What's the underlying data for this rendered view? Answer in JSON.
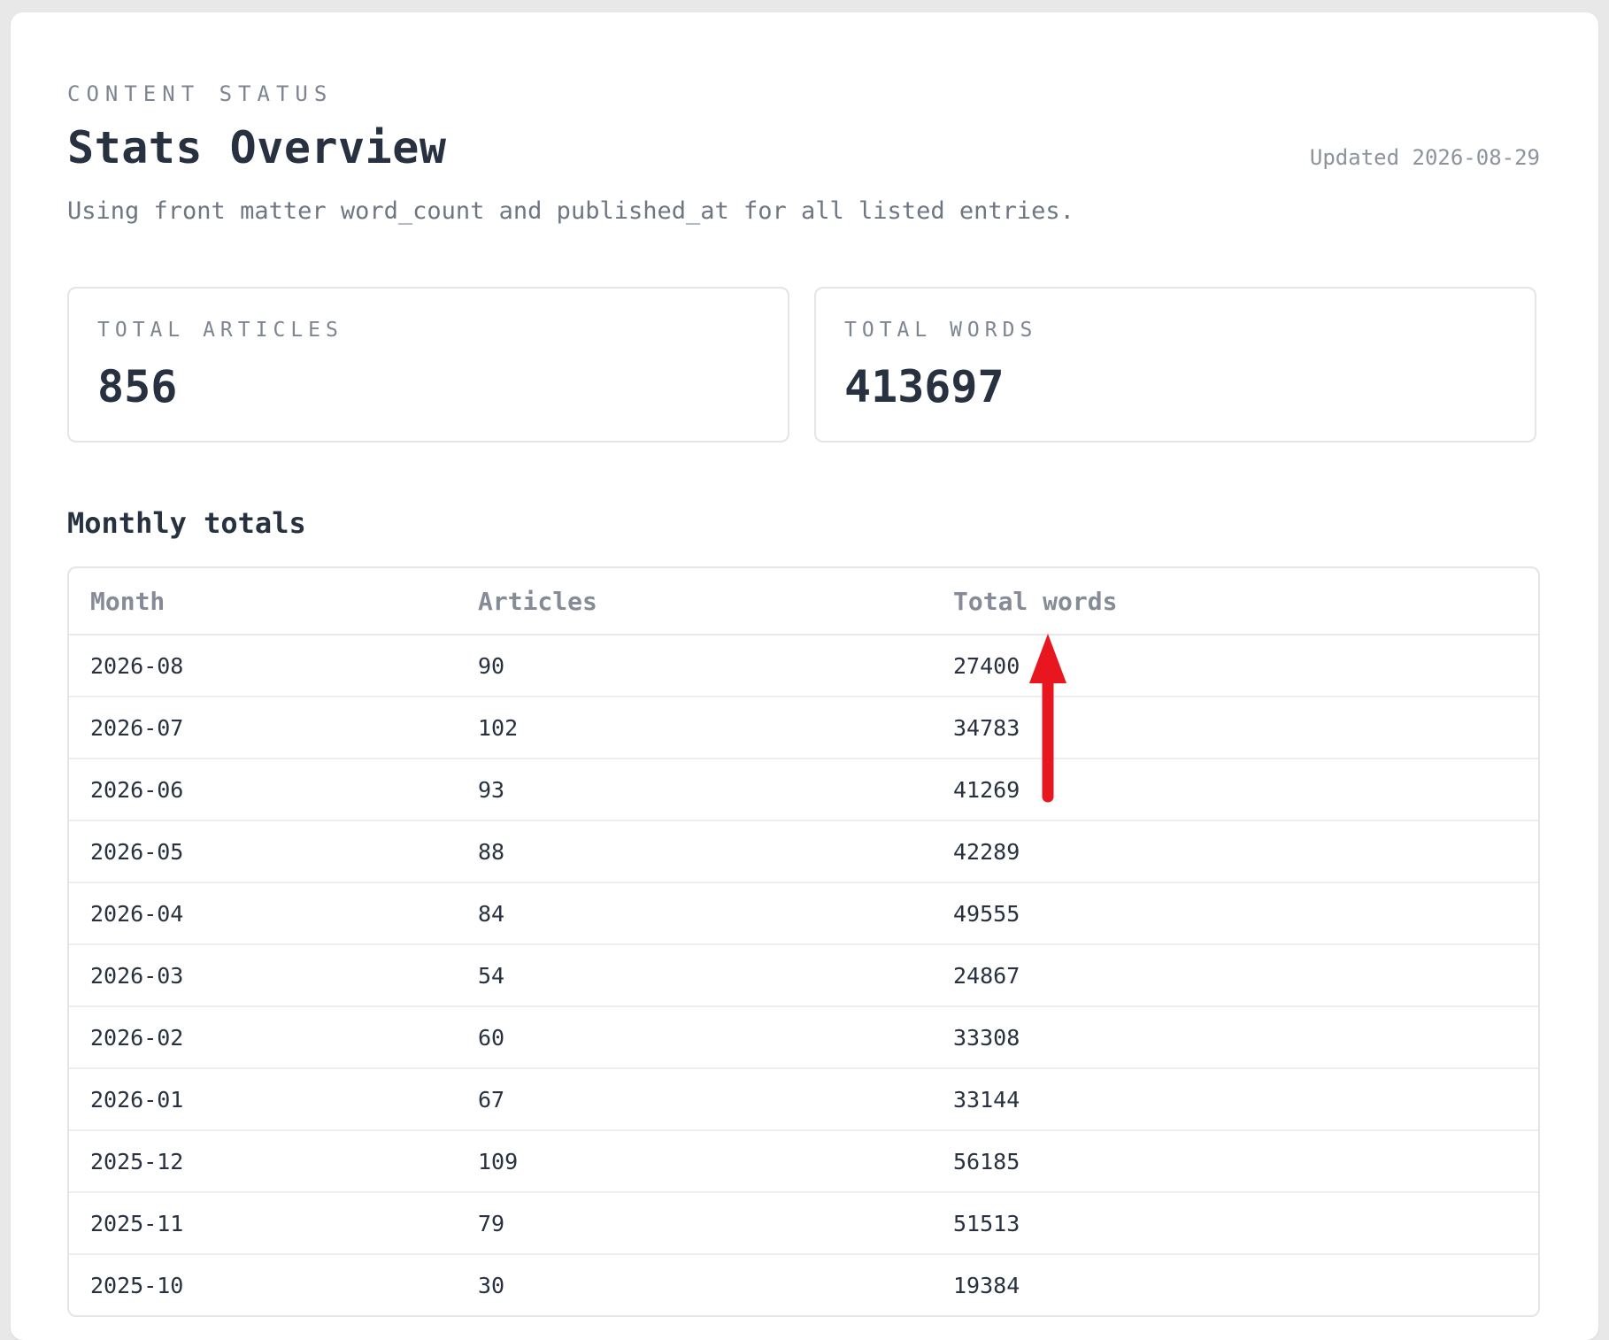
{
  "header": {
    "eyebrow": "CONTENT STATUS",
    "title": "Stats Overview",
    "updated": "Updated 2026-08-29",
    "subtitle": "Using front matter word_count and published_at for all listed entries."
  },
  "stats": {
    "articles": {
      "label": "TOTAL ARTICLES",
      "value": "856"
    },
    "words": {
      "label": "TOTAL WORDS",
      "value": "413697"
    }
  },
  "monthly": {
    "title": "Monthly totals",
    "columns": [
      "Month",
      "Articles",
      "Total words"
    ],
    "rows": [
      [
        "2026-08",
        "90",
        "27400"
      ],
      [
        "2026-07",
        "102",
        "34783"
      ],
      [
        "2026-06",
        "93",
        "41269"
      ],
      [
        "2026-05",
        "88",
        "42289"
      ],
      [
        "2026-04",
        "84",
        "49555"
      ],
      [
        "2026-03",
        "54",
        "24867"
      ],
      [
        "2026-02",
        "60",
        "33308"
      ],
      [
        "2026-01",
        "67",
        "33144"
      ],
      [
        "2025-12",
        "109",
        "56185"
      ],
      [
        "2025-11",
        "79",
        "51513"
      ],
      [
        "2025-10",
        "30",
        "19384"
      ]
    ]
  },
  "colors": {
    "background": "#e8e8e8",
    "card": "#ffffff",
    "text": "#28313f",
    "muted": "#7d8591",
    "annotation": "#e8161f"
  },
  "annotation": {
    "icon": "red-arrow-up",
    "target": "Total words"
  }
}
